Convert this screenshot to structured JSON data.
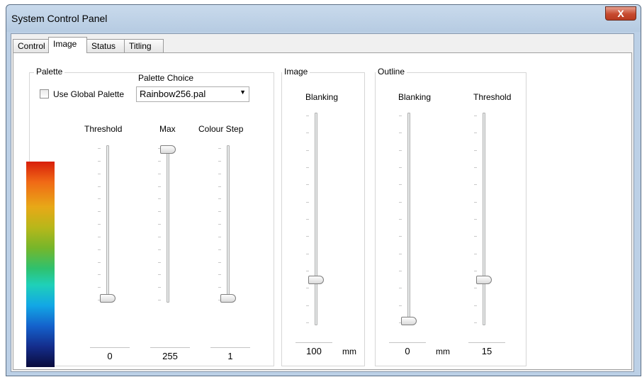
{
  "window": {
    "title": "System Control Panel",
    "close_label": "X"
  },
  "tabs": [
    {
      "label": "Control"
    },
    {
      "label": "Image"
    },
    {
      "label": "Status"
    },
    {
      "label": "Titling"
    }
  ],
  "active_tab": "Image",
  "palette": {
    "group_label": "Palette",
    "palette_choice_label": "Palette Choice",
    "palette_choice_value": "Rainbow256.pal",
    "use_global_label": "Use Global Palette",
    "use_global_checked": false,
    "threshold": {
      "label": "Threshold",
      "value": "0",
      "level": 0.0
    },
    "max": {
      "label": "Max",
      "value": "255",
      "level": 1.0
    },
    "colour_step": {
      "label": "Colour Step",
      "value": "1",
      "level": 0.0
    }
  },
  "image": {
    "group_label": "Image",
    "blanking": {
      "label": "Blanking",
      "value": "100",
      "unit": "mm",
      "level": 0.2
    }
  },
  "outline": {
    "group_label": "Outline",
    "blanking": {
      "label": "Blanking",
      "value": "0",
      "unit": "mm",
      "level": 0.0
    },
    "threshold": {
      "label": "Threshold",
      "value": "15",
      "level": 0.2
    }
  },
  "colors": {
    "accent": "#c74a2f",
    "window_frame": "#bcd0e6"
  }
}
